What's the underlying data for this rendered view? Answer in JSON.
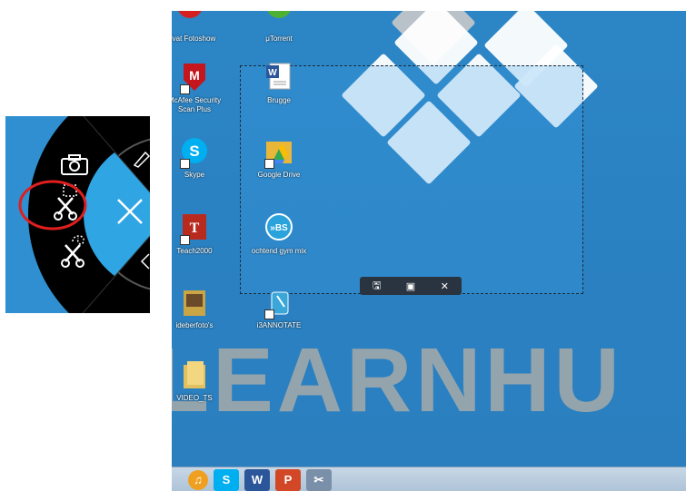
{
  "inset": {
    "tools": [
      {
        "icon": "camera-icon",
        "label": "Full screen capture"
      },
      {
        "icon": "rectangle-scissors-icon",
        "label": "Rectangular capture",
        "highlighted": true
      },
      {
        "icon": "freeform-scissors-icon",
        "label": "Free-form capture"
      },
      {
        "icon": "close-icon",
        "label": "Close"
      },
      {
        "icon": "pen-icon",
        "label": "Pen"
      }
    ],
    "colors": {
      "ring": "#000000",
      "wedge": "#2fa6e3",
      "highlight": "#e01e1e",
      "background": "#2f8fd0"
    }
  },
  "desktop": {
    "watermark_text": "LEARNHU",
    "icons": [
      {
        "label": "advat Fotoshow",
        "icon": "fotoshow-icon"
      },
      {
        "label": "μTorrent",
        "icon": "utorrent-icon"
      },
      {
        "label": "McAfee Security Scan Plus",
        "icon": "mcafee-icon"
      },
      {
        "label": "Brugge",
        "icon": "word-document-icon"
      },
      {
        "label": "Skype",
        "icon": "skype-icon"
      },
      {
        "label": "Google Drive",
        "icon": "google-drive-icon"
      },
      {
        "label": "Teach2000",
        "icon": "teach2000-icon"
      },
      {
        "label": "ochtend gym mix",
        "icon": "media-playlist-icon"
      },
      {
        "label": "ideberfoto's",
        "icon": "folder-photos-icon"
      },
      {
        "label": "i3ANNOTATE",
        "icon": "i3annotate-icon"
      },
      {
        "label": "VIDEO_TS",
        "icon": "folder-icon"
      }
    ],
    "selection_toolbar": [
      {
        "icon": "save-icon",
        "glyph": "🖫"
      },
      {
        "icon": "copy-window-icon",
        "glyph": "▣"
      },
      {
        "icon": "close-icon",
        "glyph": "✕"
      }
    ],
    "taskbar": [
      {
        "icon": "itunes-icon",
        "glyph": "♫",
        "color": "#f0a020"
      },
      {
        "icon": "skype-taskbar-icon",
        "glyph": "S",
        "color": "#00aff0"
      },
      {
        "icon": "word-taskbar-icon",
        "glyph": "W",
        "color": "#2b579a"
      },
      {
        "icon": "powerpoint-taskbar-icon",
        "glyph": "P",
        "color": "#d24726"
      },
      {
        "icon": "snipping-tool-taskbar-icon",
        "glyph": "✂",
        "color": "#7a8fa8"
      }
    ]
  }
}
